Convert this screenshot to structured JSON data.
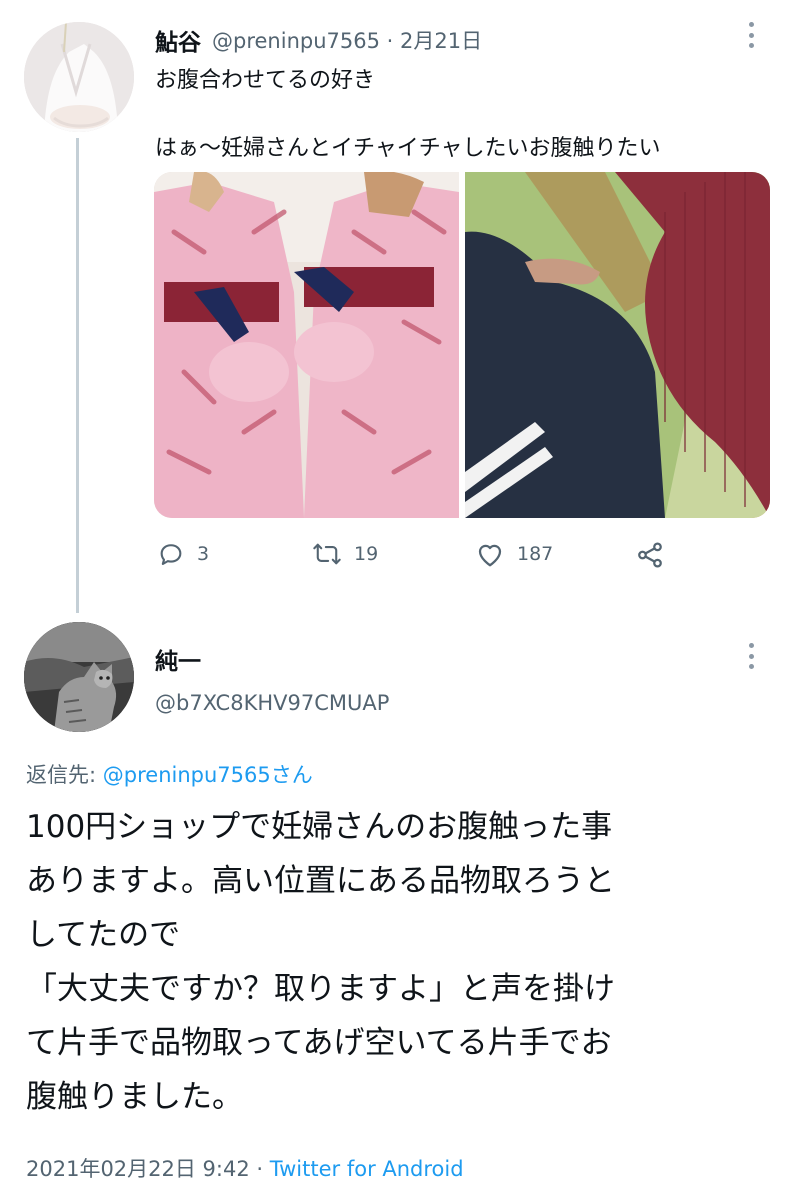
{
  "parent_tweet": {
    "author_name": "鮎谷",
    "handle": "@preninpu7565",
    "separator": "·",
    "date": "2月21日",
    "text_line1": "お腹合わせてるの好き",
    "text_line2": "はぁ〜妊婦さんとイチャイチャしたいお腹触りたい",
    "actions": {
      "reply_count": "3",
      "retweet_count": "19",
      "like_count": "187"
    }
  },
  "reply_tweet": {
    "author_name": "純一",
    "handle": "@b7XC8KHV97CMUAP",
    "replying_prefix": "返信先: ",
    "replying_mention": "@preninpu7565さん",
    "body_lines": [
      "100円ショップで妊婦さんのお腹触った事",
      "ありますよ。高い位置にある品物取ろうと",
      "してたので",
      "「大丈夫ですか？取りますよ」と声を掛け",
      "て片手で品物取ってあげ空いてる片手でお",
      "腹触りました。"
    ],
    "timestamp": "2021年02月22日 9:42",
    "separator": " · ",
    "source": "Twitter for Android"
  },
  "icons": {
    "reply": "reply-icon",
    "retweet": "retweet-icon",
    "like": "heart-icon",
    "share": "share-icon",
    "more": "more-vertical-icon"
  },
  "colors": {
    "text": "#0f1419",
    "secondary": "#536471",
    "link": "#1d9bf0",
    "thread_line": "#c4cfd6"
  }
}
